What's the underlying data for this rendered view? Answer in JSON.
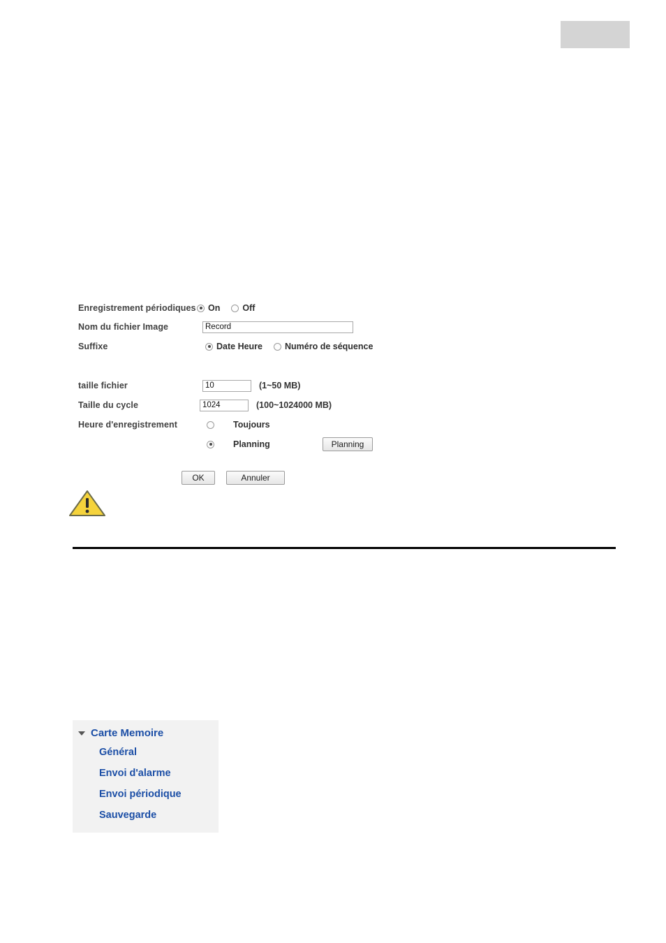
{
  "header": {
    "block_label": ""
  },
  "form": {
    "rows": {
      "periodic_record": {
        "label": "Enregistrement périodiques",
        "options": [
          {
            "label": "On",
            "checked": true
          },
          {
            "label": "Off",
            "checked": false
          }
        ]
      },
      "file_name": {
        "label": "Nom du fichier Image",
        "value": "Record"
      },
      "suffix": {
        "label": "Suffixe",
        "options": [
          {
            "label": "Date Heure",
            "checked": true
          },
          {
            "label": "Numéro de séquence",
            "checked": false
          }
        ]
      },
      "file_size": {
        "label": "taille fichier",
        "value": "10",
        "hint": "(1~50 MB)"
      },
      "cycle_size": {
        "label": "Taille du cycle",
        "value": "1024",
        "hint": "(100~1024000 MB)"
      },
      "record_time": {
        "label": "Heure d'enregistrement",
        "options": [
          {
            "label": "Toujours",
            "checked": false
          },
          {
            "label": "Planning",
            "checked": true
          }
        ],
        "button_label": "Planning"
      }
    },
    "buttons": {
      "ok": "OK",
      "cancel": "Annuler"
    }
  },
  "menu": {
    "root": "Carte Memoire",
    "items": [
      {
        "label": "Général"
      },
      {
        "label": "Envoi d'alarme"
      },
      {
        "label": "Envoi périodique"
      },
      {
        "label": "Sauvegarde"
      }
    ]
  }
}
